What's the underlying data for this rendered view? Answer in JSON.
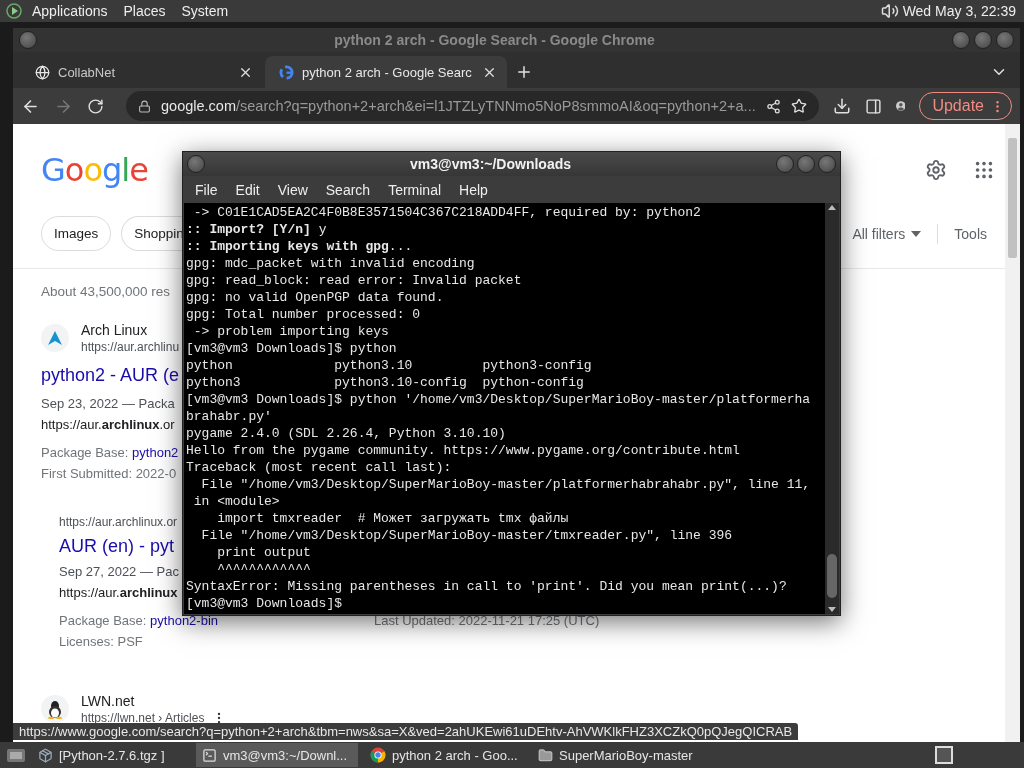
{
  "top_panel": {
    "menus": [
      "Applications",
      "Places",
      "System"
    ],
    "clock": "Wed May  3, 22:39"
  },
  "browser": {
    "title": "python 2 arch - Google Search - Google Chrome",
    "tabs": [
      {
        "label": "CollabNet",
        "selected": false,
        "kind": "globe"
      },
      {
        "label": "python 2 arch - Google Searc",
        "selected": true,
        "kind": "google"
      }
    ],
    "address": {
      "host": "google.com",
      "path": "/search?q=python+2+arch&ei=l1JTZLyTNNmo5NoP8smmoAI&oq=python+2+a..."
    },
    "update_button": "Update",
    "status_url": "https://www.google.com/search?q=python+2+arch&tbm=nws&sa=X&ved=2ahUKEwi61uDEhtv-AhVWKlkFHZ3XCZkQ0pQJegQICRAB"
  },
  "search_page": {
    "logo": "Google",
    "chips": [
      "Images",
      "Shoppin"
    ],
    "filters": [
      {
        "label": "All filters",
        "kind": "dropdown"
      },
      {
        "label": "Tools",
        "kind": "plain"
      }
    ],
    "result_stats": "About 43,500,000 res",
    "results": [
      {
        "kind": "arch",
        "site": "Arch Linux",
        "url": "https://aur.archlinu",
        "title": "python2 - AUR (e",
        "snippet": "Sep 23, 2022 — Packa",
        "snippet_url": "https://aur.**archlinux**.or",
        "details": [
          {
            "label": "Package Base:",
            "link": "python2"
          },
          {
            "label": "First Submitted: 2022-0"
          }
        ]
      },
      {
        "kind": "sub",
        "url": "https://aur.archlinux.or",
        "title": "AUR (en) - pyt",
        "snippet": "Sep 27, 2022 — Pac",
        "snippet_url": "https://aur.**archlinux**",
        "details": [
          {
            "label": "Package Base:",
            "link": "python2-bin",
            "side": "Last Updated: 2022-11-21 17:25 (UTC)"
          },
          {
            "label": "Licenses: PSF"
          }
        ]
      },
      {
        "kind": "penguin",
        "site": "LWN.net",
        "url": "https://lwn.net › Articles"
      }
    ]
  },
  "terminal": {
    "title": "vm3@vm3:~/Downloads",
    "menu": [
      "File",
      "Edit",
      "View",
      "Search",
      "Terminal",
      "Help"
    ],
    "lines": [
      " -> C01E1CAD5EA2C4F0B8E3571504C367C218ADD4FF, required by: python2",
      "**:: Import? [Y/n]** y",
      "**:: Importing keys with gpg**...",
      "gpg: mdc_packet with invalid encoding",
      "gpg: read_block: read error: Invalid packet",
      "gpg: no valid OpenPGP data found.",
      "gpg: Total number processed: 0",
      " -> problem importing keys",
      "[vm3@vm3 Downloads]$ python",
      "python             python3.10         python3-config",
      "python3            python3.10-config  python-config",
      "[vm3@vm3 Downloads]$ python '/home/vm3/Desktop/SuperMarioBoy-master/platformerha",
      "brahabr.py'",
      "pygame 2.4.0 (SDL 2.26.4, Python 3.10.10)",
      "Hello from the pygame community. https://www.pygame.org/contribute.html",
      "Traceback (most recent call last):",
      "  File \"/home/vm3/Desktop/SuperMarioBoy-master/platformerhabrahabr.py\", line 11,",
      " in <module>",
      "    import tmxreader  # Может загружать tmx файлы",
      "  File \"/home/vm3/Desktop/SuperMarioBoy-master/tmxreader.py\", line 396",
      "    print output",
      "    ^^^^^^^^^^^^",
      "SyntaxError: Missing parentheses in call to 'print'. Did you mean print(...)?",
      "[vm3@vm3 Downloads]$"
    ]
  },
  "taskbar": {
    "items": [
      {
        "label": "[Python-2.7.6.tgz ]",
        "selected": false,
        "kind": "archive"
      },
      {
        "label": "vm3@vm3:~/Downl...",
        "selected": true,
        "kind": "terminal"
      },
      {
        "label": "python 2 arch - Goo...",
        "selected": false,
        "kind": "chrome"
      },
      {
        "label": "SuperMarioBoy-master",
        "selected": false,
        "kind": "folder"
      }
    ]
  }
}
